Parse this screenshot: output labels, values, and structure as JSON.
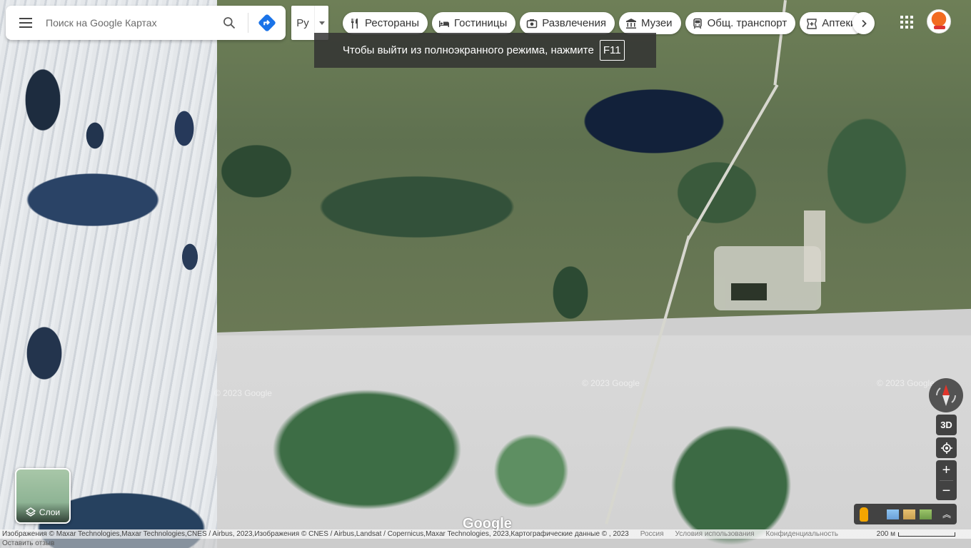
{
  "search": {
    "placeholder": "Поиск на Google Картах",
    "menu_icon": "hamburger-menu-icon",
    "search_icon": "search-icon",
    "directions_icon": "directions-icon"
  },
  "language": {
    "value": "Ру"
  },
  "categories": [
    {
      "label": "Рестораны",
      "icon": "restaurant-icon"
    },
    {
      "label": "Гостиницы",
      "icon": "hotel-icon"
    },
    {
      "label": "Развлечения",
      "icon": "camera-icon"
    },
    {
      "label": "Музеи",
      "icon": "museum-icon"
    },
    {
      "label": "Общ. транспорт",
      "icon": "transit-icon"
    },
    {
      "label": "Аптеки",
      "icon": "pharmacy-icon"
    }
  ],
  "fullscreen_toast": {
    "text": "Чтобы выйти из полноэкранного режима, нажмите",
    "key": "F11"
  },
  "controls": {
    "tilt_label": "3D",
    "zoom_in": "+",
    "zoom_out": "−"
  },
  "layers": {
    "label": "Слои"
  },
  "map_watermarks": [
    "© 2023 Google",
    "© 2023 Google",
    "© 2023 Google"
  ],
  "google_logo": "Google",
  "footer": {
    "attribution": "Изображения © Maxar Technologies,Maxar Technologies,CNES / Airbus, 2023,Изображения © CNES / Airbus,Landsat / Copernicus,Maxar Technologies, 2023,Картографические данные © , 2023",
    "country": "Россия",
    "terms": "Условия использования",
    "privacy": "Конфиденциальность",
    "scale": "200 м",
    "feedback": "Оставить отзыв"
  },
  "colors": {
    "accent_blue": "#1a73e8",
    "pegman_yellow": "#f2a500"
  }
}
